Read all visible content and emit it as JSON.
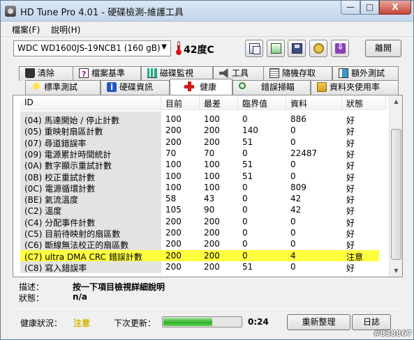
{
  "window": {
    "title": "HD Tune Pro 4.01 - 硬碟檢測-維護工具",
    "min": "—",
    "max": "□",
    "close": "X"
  },
  "menu": [
    "檔案(F)",
    "說明(H)"
  ],
  "toolbar": {
    "drive": "WDC WD1600JS-19NCB1 (160 gB)",
    "temperature": "42度C",
    "exit_label": "離開",
    "buttons": [
      "copy-icon",
      "paste-icon",
      "save-icon",
      "options-icon",
      "download-icon"
    ]
  },
  "tabs_row1": [
    "清除",
    "檔案基準",
    "磁碟監視",
    "工具",
    "隨機存取",
    "額外測試"
  ],
  "tabs_row2": [
    "標準測試",
    "硬碟資訊",
    "健康",
    "錯誤掃瞄",
    "資料夾使用率"
  ],
  "active_tab": "健康",
  "table": {
    "headers": [
      "ID",
      "目前",
      "最差",
      "臨界值",
      "資料",
      "狀態"
    ],
    "rows": [
      [
        "(04) 馬達開始 / 停止計數",
        "100",
        "100",
        "0",
        "886",
        "好"
      ],
      [
        "(05) 重映射扇區計數",
        "200",
        "200",
        "140",
        "0",
        "好"
      ],
      [
        "(07) 尋道錯誤率",
        "200",
        "200",
        "51",
        "0",
        "好"
      ],
      [
        "(09) 電源累計時間統計",
        "70",
        "70",
        "0",
        "22487",
        "好"
      ],
      [
        "(0A) 數字顯示重試計數",
        "100",
        "100",
        "51",
        "0",
        "好"
      ],
      [
        "(0B) 校正重試計數",
        "100",
        "100",
        "51",
        "0",
        "好"
      ],
      [
        "(0C) 電源循環計數",
        "100",
        "100",
        "0",
        "809",
        "好"
      ],
      [
        "(BE) 氣流溫度",
        "58",
        "43",
        "0",
        "42",
        "好"
      ],
      [
        "(C2) 溫度",
        "105",
        "90",
        "0",
        "42",
        "好"
      ],
      [
        "(C4) 分配事件計數",
        "200",
        "200",
        "0",
        "0",
        "好"
      ],
      [
        "(C5) 目前待映射的扇區數",
        "200",
        "200",
        "0",
        "0",
        "好"
      ],
      [
        "(C6) 斷線無法校正的扇區數",
        "200",
        "200",
        "0",
        "0",
        "好"
      ],
      [
        "(C7) ultra DMA CRC 錯誤計數",
        "200",
        "200",
        "0",
        "4",
        "注意"
      ],
      [
        "(C8) 寫入錯誤率",
        "200",
        "200",
        "51",
        "0",
        "好"
      ]
    ],
    "highlight_row": 12
  },
  "description": {
    "desc_label": "描述：",
    "desc_value": "按一下項目檢視詳細說明",
    "status_label": "狀態：",
    "status_value": "n/a"
  },
  "status": {
    "health_label": "健康狀況：",
    "health_value": "注意",
    "health_color": "#d6b400",
    "next_label": "下次更新：",
    "progress": 0.62,
    "countdown": "0:24",
    "refresh_label": "重新整理",
    "log_label": "日誌"
  },
  "watermark": "#838867"
}
